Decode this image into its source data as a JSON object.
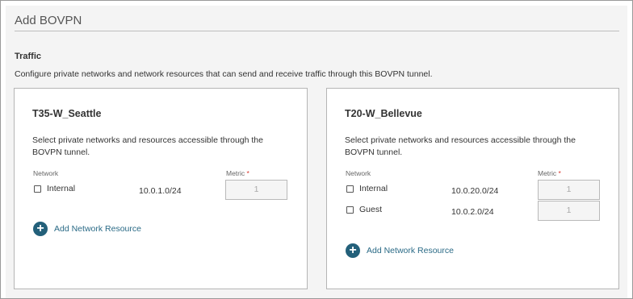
{
  "page": {
    "title": "Add BOVPN"
  },
  "traffic": {
    "heading": "Traffic",
    "description": "Configure private networks and network resources that can send and receive traffic through this BOVPN tunnel."
  },
  "gateways": [
    {
      "name": "T35-W_Seattle",
      "description": "Select private networks and resources accessible through the BOVPN tunnel.",
      "network_label": "Network",
      "metric_label": "Metric",
      "required_mark": "*",
      "rows": [
        {
          "name": "Internal",
          "ip": "10.0.1.0/24",
          "metric": "1",
          "checked": false
        }
      ],
      "add_label": "Add Network Resource"
    },
    {
      "name": "T20-W_Bellevue",
      "description": "Select private networks and resources accessible through the BOVPN tunnel.",
      "network_label": "Network",
      "metric_label": "Metric",
      "required_mark": "*",
      "rows": [
        {
          "name": "Internal",
          "ip": "10.0.20.0/24",
          "metric": "1",
          "checked": false
        },
        {
          "name": "Guest",
          "ip": "10.0.2.0/24",
          "metric": "1",
          "checked": false
        }
      ],
      "add_label": "Add Network Resource"
    }
  ],
  "icons": {
    "add": "plus-circle-icon",
    "add_glyph": "+"
  },
  "colors": {
    "accent": "#23607a",
    "link": "#2a6a86",
    "required": "#d9342b"
  }
}
